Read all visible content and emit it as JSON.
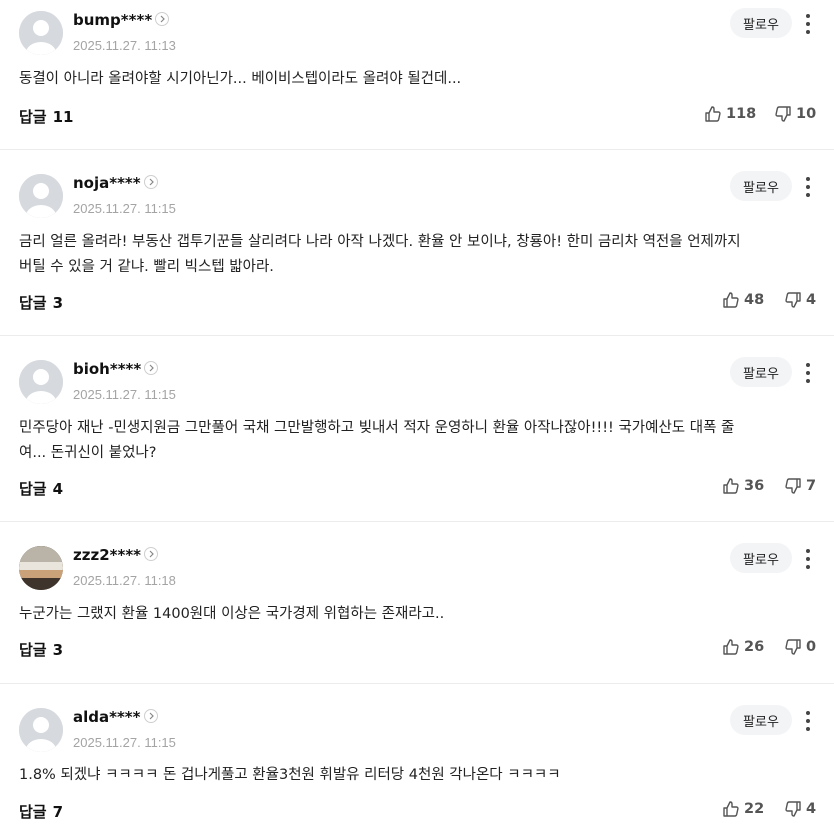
{
  "follow_label": "팔로우",
  "reply_label": "답글",
  "comments": [
    {
      "nickname": "bump****",
      "time": "2025.11.27. 11:13",
      "text": "동결이 아니라 올려야할 시기아닌가... 베이비스텝이라도 올려야 될건데...",
      "replies": "11",
      "likes": "118",
      "dislikes": "10",
      "avatar": "default-avatar"
    },
    {
      "nickname": "noja****",
      "time": "2025.11.27. 11:15",
      "text": "금리 얼른 올려라! 부동산 갭투기꾼들 살리려다 나라 아작 나겠다. 환율 안 보이냐, 창룡아! 한미 금리차 역전을 언제까지\n버틸 수 있을 거 같냐. 빨리 빅스텝 밟아라.",
      "replies": "3",
      "likes": "48",
      "dislikes": "4",
      "avatar": "default-avatar"
    },
    {
      "nickname": "bioh****",
      "time": "2025.11.27. 11:15",
      "text": "민주당아 재난 -민생지원금 그만풀어 국채 그만발행하고 빚내서 적자 운영하니 환율 아작나잖아!!!! 국가예산도 대폭 줄\n여... 돈귀신이 붙었나?",
      "replies": "4",
      "likes": "36",
      "dislikes": "7",
      "avatar": "default-avatar"
    },
    {
      "nickname": "zzz2****",
      "time": "2025.11.27. 11:18",
      "text": "누군가는 그랬지 환율 1400원대 이상은 국가경제 위협하는 존재라고..",
      "replies": "3",
      "likes": "26",
      "dislikes": "0",
      "avatar": "photo-avatar"
    },
    {
      "nickname": "alda****",
      "time": "2025.11.27. 11:15",
      "text": "1.8% 되겠냐 ㅋㅋㅋㅋ 돈 겁나게풀고 환율3천원 휘발유 리터당 4천원 각나온다 ㅋㅋㅋㅋ",
      "replies": "7",
      "likes": "22",
      "dislikes": "4",
      "avatar": "default-avatar"
    }
  ]
}
